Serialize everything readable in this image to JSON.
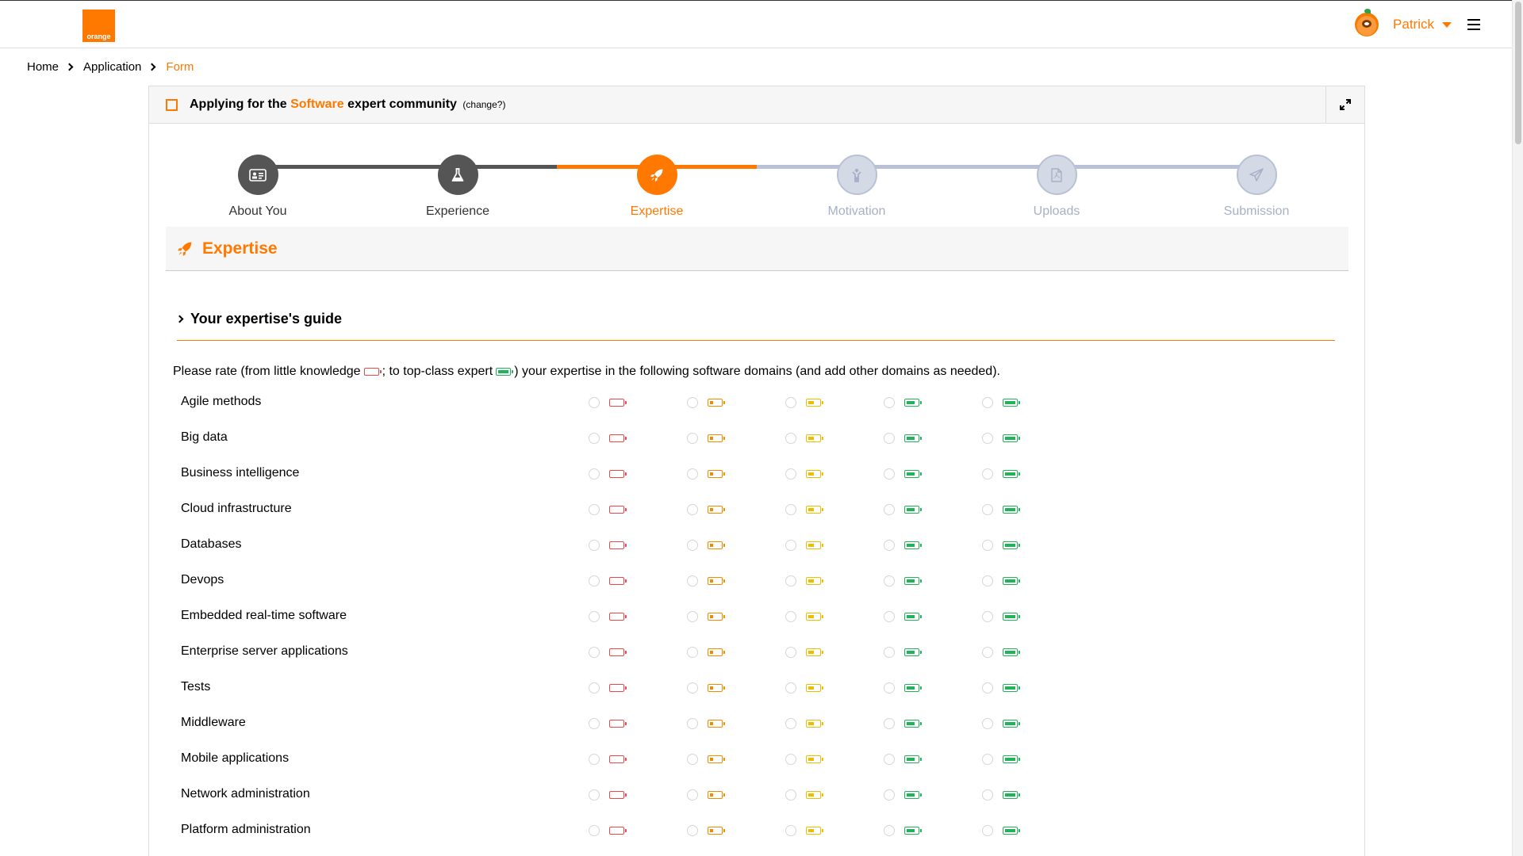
{
  "navbar": {
    "logo_text": "orange",
    "user_name": "Patrick"
  },
  "breadcrumb": [
    {
      "label": "Home"
    },
    {
      "label": "Application"
    },
    {
      "label": "Form"
    }
  ],
  "header": {
    "prefix": "Applying for the",
    "community": "Software",
    "suffix": "expert community",
    "change_link": "(change?)"
  },
  "steps": [
    {
      "label": "About You",
      "state": "done",
      "icon": "id-card-icon"
    },
    {
      "label": "Experience",
      "state": "done",
      "icon": "flask-icon"
    },
    {
      "label": "Expertise",
      "state": "current",
      "icon": "rocket-icon"
    },
    {
      "label": "Motivation",
      "state": "todo",
      "icon": "person-icon"
    },
    {
      "label": "Uploads",
      "state": "todo",
      "icon": "pdf-file-icon"
    },
    {
      "label": "Submission",
      "state": "todo",
      "icon": "paper-plane-icon"
    }
  ],
  "section": {
    "title": "Expertise",
    "guide_title": "Your expertise's guide",
    "intro": {
      "part1": "Please rate (from little knowledge",
      "part2": "; to top-class expert",
      "part3": ") your expertise in the following software domains (and add other domains as needed)."
    }
  },
  "colors": {
    "accent": "#ff7900",
    "level0": "#e84a4a",
    "level1": "#f08c00",
    "level2": "#eebd00",
    "level3": "#22b35a",
    "level4": "#22b35a"
  },
  "rating_levels": 5,
  "domains": [
    "Agile methods",
    "Big data",
    "Business intelligence",
    "Cloud infrastructure",
    "Databases",
    "Devops",
    "Embedded real-time software",
    "Enterprise server applications",
    "Tests",
    "Middleware",
    "Mobile applications",
    "Network administration",
    "Platform administration"
  ]
}
